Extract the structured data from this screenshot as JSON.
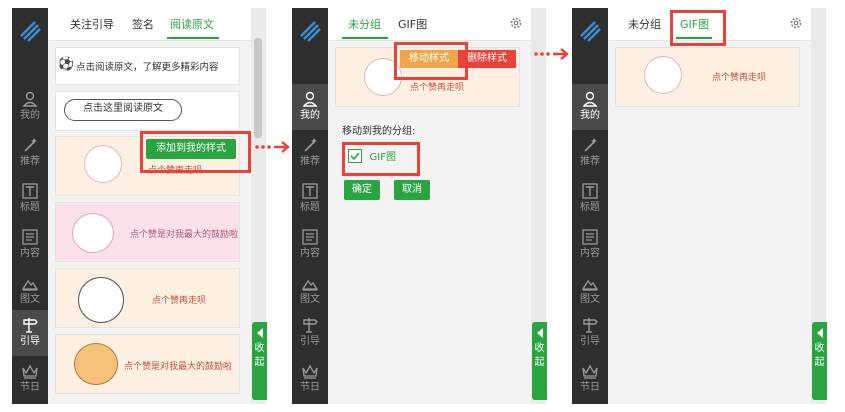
{
  "sidebar": {
    "items": [
      {
        "label": "我的",
        "icon": "user-icon"
      },
      {
        "label": "推荐",
        "icon": "magic-wand-icon"
      },
      {
        "label": "标题",
        "icon": "title-t-icon"
      },
      {
        "label": "内容",
        "icon": "content-doc-icon"
      },
      {
        "label": "图文",
        "icon": "image-mountain-icon"
      },
      {
        "label": "引导",
        "icon": "signpost-icon"
      },
      {
        "label": "节日",
        "icon": "crown-icon"
      }
    ]
  },
  "panel1": {
    "tabs": [
      "关注引导",
      "签名",
      "阅读原文"
    ],
    "active_tab": "阅读原文",
    "banner_text": "点击阅读原文，了解更多精彩内容",
    "bubble_text": "点击这里阅读原文",
    "add_button_label": "添加到我的样式",
    "cards": [
      {
        "text": "点个赞再走呗"
      },
      {
        "text": "点个赞是对我最大的鼓励啦"
      },
      {
        "text": "点个赞再走呗"
      },
      {
        "text": "点个赞是对我最大的鼓励啦"
      }
    ],
    "collapse_label": [
      "收",
      "起"
    ]
  },
  "panel2": {
    "tabs": [
      "未分组",
      "GIF图"
    ],
    "active_tab": "未分组",
    "move_style_label": "移动样式",
    "delete_style_label": "删除样式",
    "card_text": "点个赞再走呗",
    "move_to_group_label": "移动到我的分组:",
    "group_option": "GIF图",
    "confirm_label": "确定",
    "cancel_label": "取消",
    "collapse_label": [
      "收",
      "起"
    ]
  },
  "panel3": {
    "tabs": [
      "未分组",
      "GIF图"
    ],
    "active_tab": "GIF图",
    "card_text": "点个赞再走呗",
    "collapse_label": [
      "收",
      "起"
    ]
  },
  "arrows": "••→",
  "colors": {
    "accent": "#2aa441",
    "highlight": "#e8423b",
    "sidebar": "#2e2e2e"
  }
}
